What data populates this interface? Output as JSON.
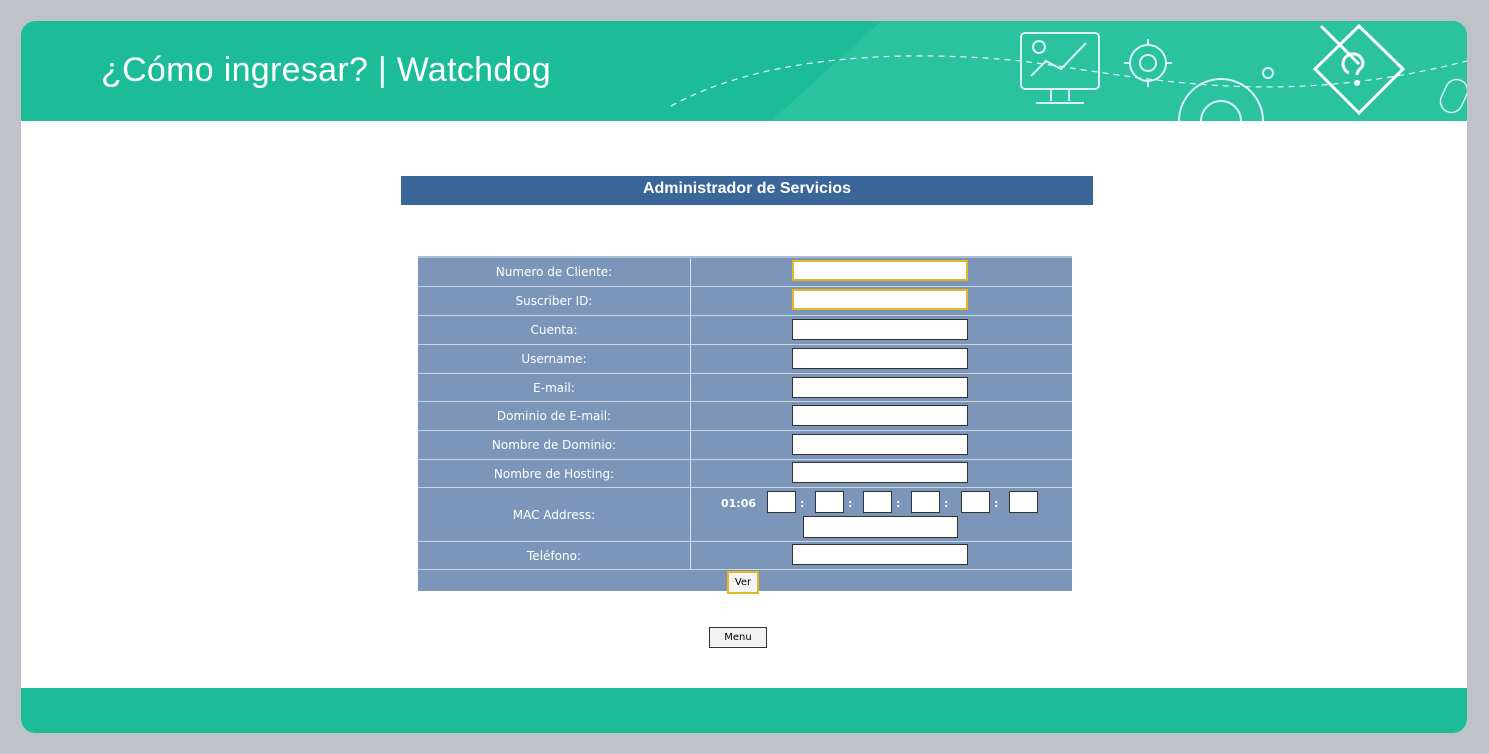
{
  "header": {
    "title": "¿Cómo ingresar? | Watchdog"
  },
  "form": {
    "title": "Administrador de Servicios",
    "fields": [
      {
        "label": "Numero de Cliente:",
        "value": ""
      },
      {
        "label": "Suscriber ID:",
        "value": ""
      },
      {
        "label": "Cuenta:",
        "value": ""
      },
      {
        "label": "Username:",
        "value": ""
      },
      {
        "label": "E-mail:",
        "value": ""
      },
      {
        "label": "Dominio de E-mail:",
        "value": ""
      },
      {
        "label": "Nombre de Dominio:",
        "value": ""
      },
      {
        "label": "Nombre de Hosting:",
        "value": ""
      }
    ],
    "mac": {
      "label": "MAC Address:",
      "prefix": "01:06",
      "separator": ":"
    },
    "phone": {
      "label": "Teléfono:",
      "value": ""
    },
    "submit_label": "Ver",
    "menu_label": "Menu"
  },
  "colors": {
    "accent": "#1cbc98",
    "form_header": "#3a6699",
    "form_body": "#7b96b8",
    "highlight": "#e6b71e"
  },
  "icons": [
    "monitor-chart-icon",
    "gear-icon",
    "gear-outline-icon",
    "pencil-help-diamond-icon",
    "mouse-icon"
  ]
}
